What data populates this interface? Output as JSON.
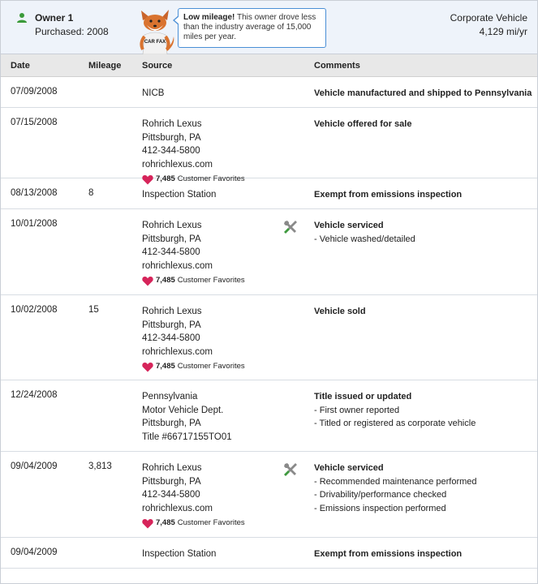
{
  "owner": {
    "name": "Owner 1",
    "purchased": "Purchased: 2008",
    "tip_bold": "Low mileage!",
    "tip_text": " This owner drove less than the industry average of 15,000 miles per year.",
    "type": "Corporate Vehicle",
    "rate": "4,129 mi/yr",
    "mascot_badge": "CAR FAX"
  },
  "columns": {
    "date": "Date",
    "mileage": "Mileage",
    "source": "Source",
    "comments": "Comments"
  },
  "favorites_label": "Customer Favorites",
  "colors": {
    "header_bg": "#eef3fa",
    "heart": "#d6245a",
    "owner_icon": "#3a9a3a",
    "bubble_border": "#4a8fd6"
  },
  "rows": [
    {
      "date": "07/09/2008",
      "mileage": "",
      "source": [
        "NICB"
      ],
      "favorites": "",
      "comment_title": "Vehicle manufactured and shipped to Pennsylvania",
      "comment_lines": [],
      "service_icon": false
    },
    {
      "date": "07/15/2008",
      "mileage": "",
      "source": [
        "Rohrich Lexus",
        "Pittsburgh, PA",
        "412-344-5800",
        "rohrichlexus.com"
      ],
      "favorites": "7,485",
      "comment_title": "Vehicle offered for sale",
      "comment_lines": [],
      "service_icon": false
    },
    {
      "date": "08/13/2008",
      "mileage": "8",
      "source": [
        "Inspection Station"
      ],
      "favorites": "",
      "comment_title": "Exempt from emissions inspection",
      "comment_lines": [],
      "service_icon": false
    },
    {
      "date": "10/01/2008",
      "mileage": "",
      "source": [
        "Rohrich Lexus",
        "Pittsburgh, PA",
        "412-344-5800",
        "rohrichlexus.com"
      ],
      "favorites": "7,485",
      "comment_title": "Vehicle serviced",
      "comment_lines": [
        "- Vehicle washed/detailed"
      ],
      "service_icon": true
    },
    {
      "date": "10/02/2008",
      "mileage": "15",
      "source": [
        "Rohrich Lexus",
        "Pittsburgh, PA",
        "412-344-5800",
        "rohrichlexus.com"
      ],
      "favorites": "7,485",
      "comment_title": "Vehicle sold",
      "comment_lines": [],
      "service_icon": false
    },
    {
      "date": "12/24/2008",
      "mileage": "",
      "source": [
        "Pennsylvania",
        "Motor Vehicle Dept.",
        "Pittsburgh, PA",
        "Title #66717155TO01"
      ],
      "favorites": "",
      "comment_title": "Title issued or updated",
      "comment_lines": [
        "- First owner reported",
        "- Titled or registered as corporate vehicle"
      ],
      "service_icon": false
    },
    {
      "date": "09/04/2009",
      "mileage": "3,813",
      "source": [
        "Rohrich Lexus",
        "Pittsburgh, PA",
        "412-344-5800",
        "rohrichlexus.com"
      ],
      "favorites": "7,485",
      "comment_title": "Vehicle serviced",
      "comment_lines": [
        "- Recommended maintenance performed",
        "- Drivability/performance checked",
        "- Emissions inspection performed"
      ],
      "service_icon": true
    },
    {
      "date": "09/04/2009",
      "mileage": "",
      "source": [
        "Inspection Station"
      ],
      "favorites": "",
      "comment_title": "Exempt from emissions inspection",
      "comment_lines": [],
      "service_icon": false
    }
  ]
}
